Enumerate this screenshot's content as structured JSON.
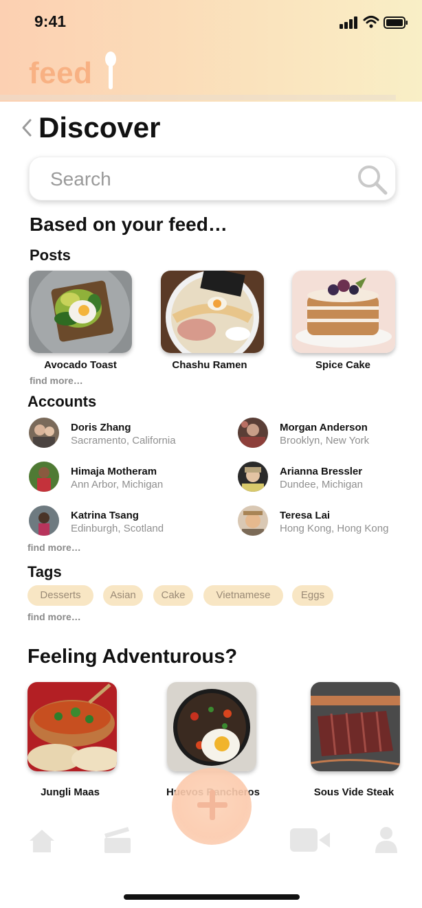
{
  "status_bar": {
    "time": "9:41"
  },
  "app": {
    "logo_text": "feed"
  },
  "page": {
    "title": "Discover"
  },
  "search": {
    "placeholder": "Search"
  },
  "feed_section": {
    "heading": "Based on your feed…",
    "posts_heading": "Posts",
    "posts": [
      {
        "label": "Avocado Toast"
      },
      {
        "label": "Chashu Ramen"
      },
      {
        "label": "Spice Cake"
      }
    ],
    "posts_find_more": "find more…",
    "accounts_heading": "Accounts",
    "accounts": [
      {
        "name": "Doris Zhang",
        "location": "Sacramento, California"
      },
      {
        "name": "Morgan Anderson",
        "location": "Brooklyn, New York"
      },
      {
        "name": "Himaja Motheram",
        "location": "Ann Arbor, Michigan"
      },
      {
        "name": "Arianna Bressler",
        "location": "Dundee, Michigan"
      },
      {
        "name": "Katrina Tsang",
        "location": "Edinburgh, Scotland"
      },
      {
        "name": "Teresa Lai",
        "location": "Hong Kong, Hong Kong"
      }
    ],
    "accounts_find_more": "find more…",
    "tags_heading": "Tags",
    "tags": [
      "Desserts",
      "Asian",
      "Cake",
      "Vietnamese",
      "Eggs"
    ],
    "tags_find_more": "find more…"
  },
  "adventurous_section": {
    "heading": "Feeling Adventurous?",
    "items": [
      {
        "label": "Jungli Maas"
      },
      {
        "label": "Huevos Rancheros"
      },
      {
        "label": "Sous Vide Steak"
      }
    ]
  },
  "nav": {
    "icons": [
      "home-icon",
      "recipe-box-icon",
      "add-icon",
      "video-icon",
      "profile-icon"
    ]
  },
  "colors": {
    "header_left": "#fcd0b2",
    "header_right": "#f9efc6",
    "logo": "#f8b183",
    "tag_bg": "#f8e6c4",
    "tag_text": "#9a8a76",
    "fab": "#fbc9ab"
  }
}
